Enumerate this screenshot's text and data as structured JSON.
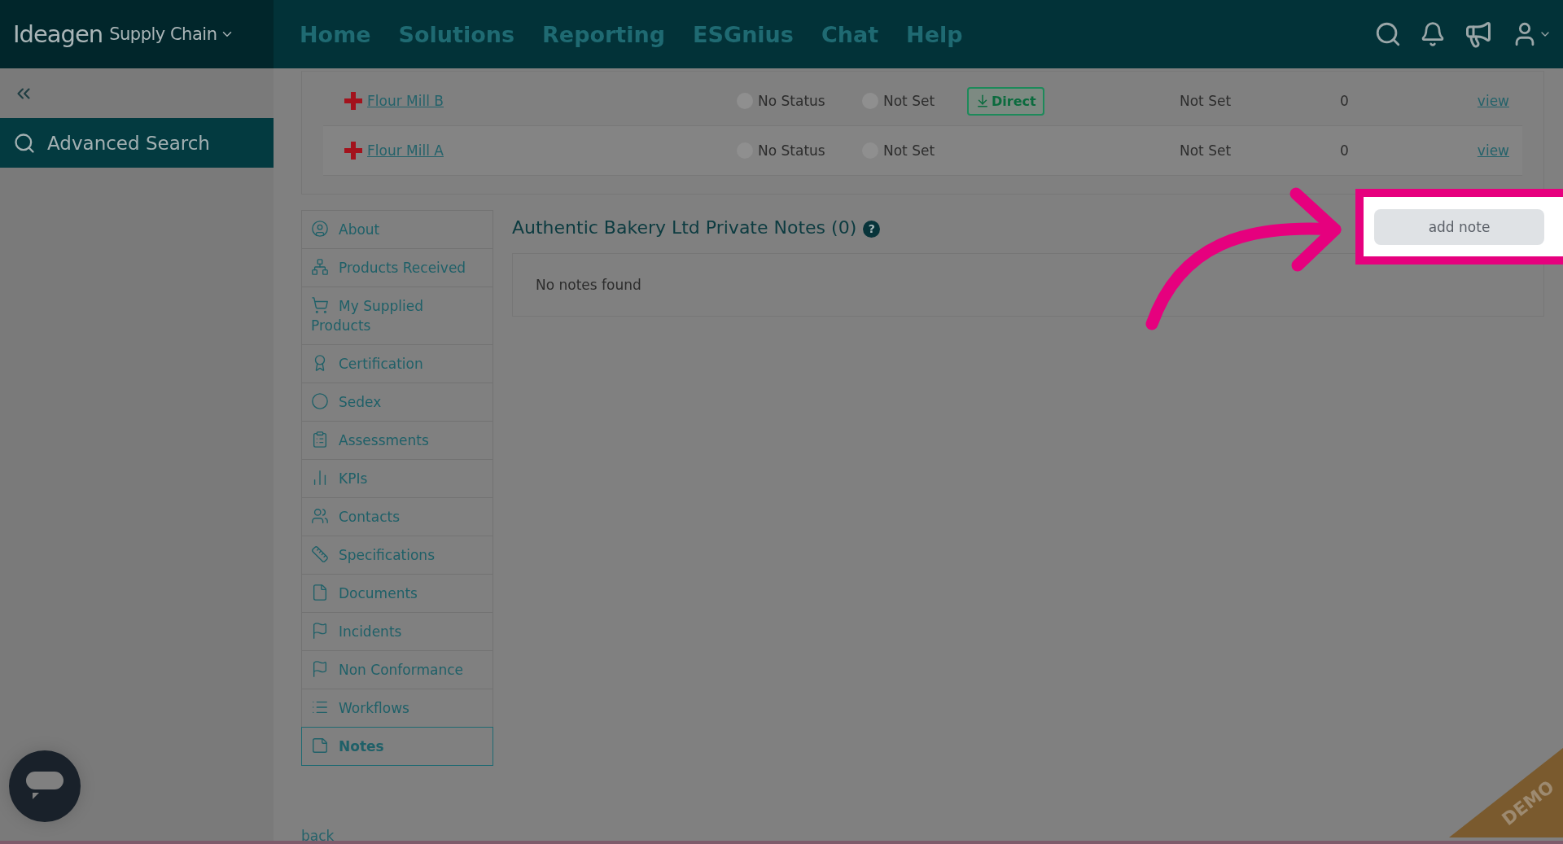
{
  "header": {
    "logo": "Ideagen",
    "product": "Supply Chain",
    "nav": [
      "Home",
      "Solutions",
      "Reporting",
      "ESGnius",
      "Chat",
      "Help"
    ]
  },
  "sidebar": {
    "items": [
      {
        "label": "Advanced Search",
        "selected": true
      }
    ]
  },
  "table": {
    "rows": [
      {
        "name": "Flour Mill B",
        "column_2": "No Status",
        "column_3": "Not Set",
        "badge": "Direct",
        "column_5": "Not Set",
        "column_6": "0",
        "link": "view"
      },
      {
        "name": "Flour Mill A",
        "column_2": "No Status",
        "column_3": "Not Set",
        "column_5": "Not Set",
        "column_6": "0",
        "link": "view"
      }
    ]
  },
  "menu": [
    {
      "label": "About",
      "selected": false
    },
    {
      "label": "Products Received",
      "selected": false
    },
    {
      "label": "My Supplied Products",
      "selected": false
    },
    {
      "label": "Certification",
      "selected": false
    },
    {
      "label": "Sedex",
      "selected": false
    },
    {
      "label": "Assessments",
      "selected": false
    },
    {
      "label": "KPIs",
      "selected": false
    },
    {
      "label": "Contacts",
      "selected": false
    },
    {
      "label": "Specifications",
      "selected": false
    },
    {
      "label": "Documents",
      "selected": false
    },
    {
      "label": "Incidents",
      "selected": false
    },
    {
      "label": "Non Conformance",
      "selected": false
    },
    {
      "label": "Workflows",
      "selected": false
    },
    {
      "label": "Notes",
      "selected": true
    }
  ],
  "notes": {
    "title": "Authentic Bakery Ltd Private Notes (0)",
    "help": "?",
    "empty": "No notes found",
    "button": "add note"
  },
  "back": "back",
  "demo": "DEMO"
}
